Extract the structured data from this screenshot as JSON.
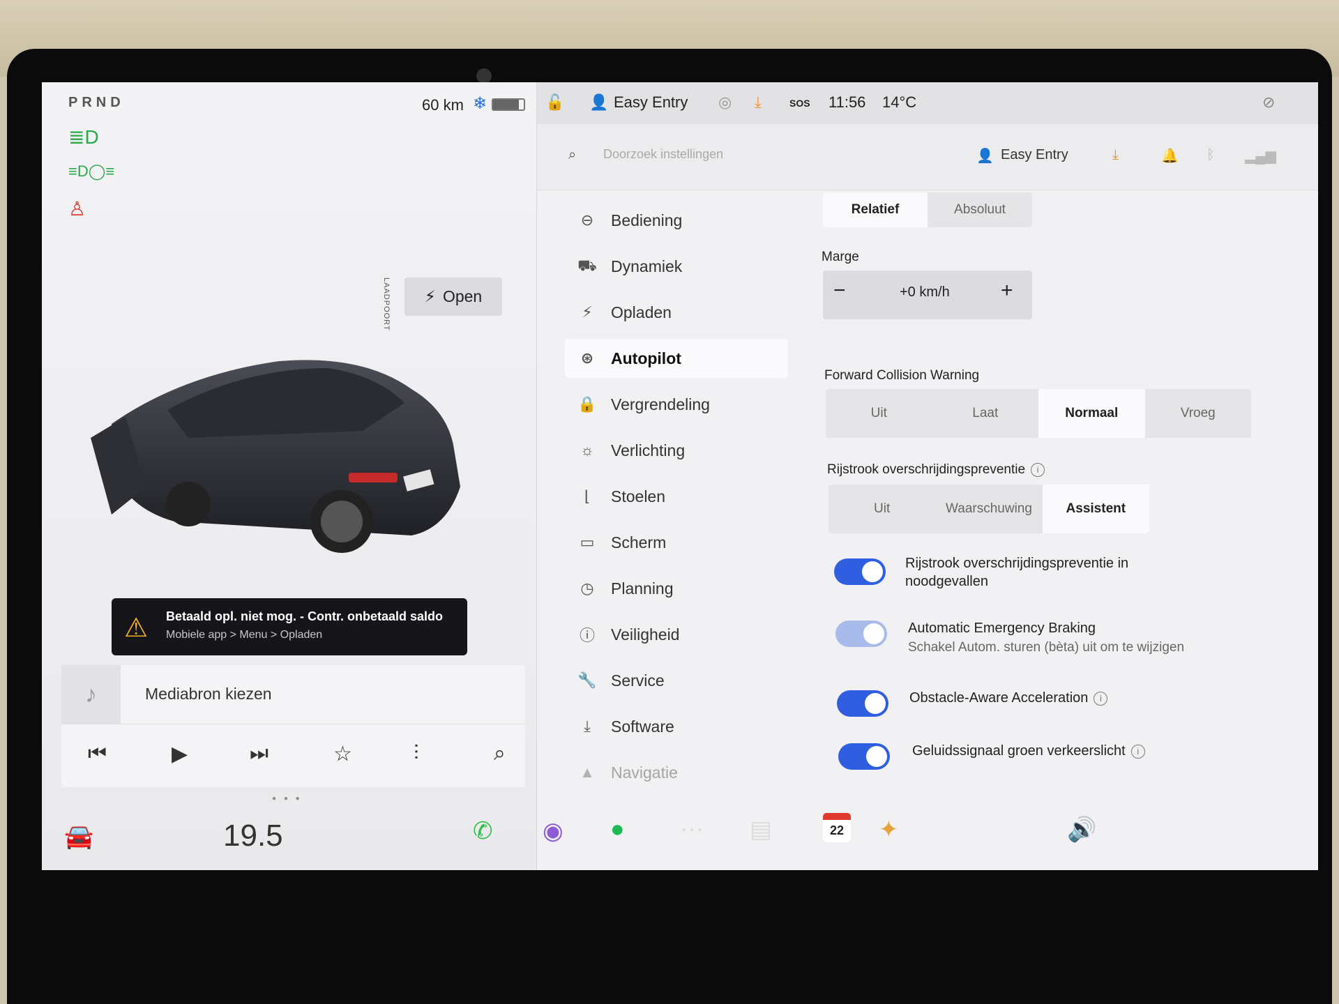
{
  "left": {
    "gear": "PRND",
    "range": "60 km",
    "battery_fraction": 0.85,
    "laadpoort_label": "LAADPOORT",
    "open_label": "Open",
    "alert": {
      "title": "Betaald opl. niet mog. - Contr. onbetaald saldo",
      "subtitle": "Mobiele app > Menu > Opladen"
    },
    "media": {
      "label": "Mediabron kiezen"
    }
  },
  "topbar": {
    "profile": "Easy Entry",
    "sos": "SOS",
    "time": "11:56",
    "temp": "14°C"
  },
  "search": {
    "placeholder": "Doorzoek instellingen",
    "profile": "Easy Entry"
  },
  "nav": {
    "items": [
      {
        "label": "Bediening",
        "icon": "toggle-icon"
      },
      {
        "label": "Dynamiek",
        "icon": "car-icon"
      },
      {
        "label": "Opladen",
        "icon": "bolt-icon"
      },
      {
        "label": "Autopilot",
        "icon": "steering-wheel-icon"
      },
      {
        "label": "Vergrendeling",
        "icon": "lock-icon"
      },
      {
        "label": "Verlichting",
        "icon": "light-icon"
      },
      {
        "label": "Stoelen",
        "icon": "seat-icon"
      },
      {
        "label": "Scherm",
        "icon": "display-icon"
      },
      {
        "label": "Planning",
        "icon": "clock-icon"
      },
      {
        "label": "Veiligheid",
        "icon": "warning-icon"
      },
      {
        "label": "Service",
        "icon": "wrench-icon"
      },
      {
        "label": "Software",
        "icon": "download-icon"
      },
      {
        "label": "Navigatie",
        "icon": "navigation-icon"
      }
    ],
    "active": "Autopilot"
  },
  "settings": {
    "speed_mode": {
      "options": [
        "Relatief",
        "Absoluut"
      ],
      "selected": "Relatief"
    },
    "marge": {
      "label": "Marge",
      "value": "+0 km/h",
      "minus": "−",
      "plus": "+"
    },
    "fcw": {
      "label": "Forward Collision Warning",
      "options": [
        "Uit",
        "Laat",
        "Normaal",
        "Vroeg"
      ],
      "selected": "Normaal"
    },
    "ldp": {
      "label": "Rijstrook overschrijdingspreventie",
      "options": [
        "Uit",
        "Waarschuwing",
        "Assistent"
      ],
      "selected": "Assistent"
    },
    "emergency_ldp": {
      "label_line1": "Rijstrook overschrijdingspreventie in",
      "label_line2": "noodgevallen",
      "on": true
    },
    "aeb": {
      "label": "Automatic Emergency Braking",
      "sub": "Schakel Autom. sturen (bèta) uit om te wijzigen",
      "on": true,
      "disabled": true
    },
    "oaa": {
      "label": "Obstacle-Aware Acceleration",
      "on": true
    },
    "green_light": {
      "label": "Geluidssignaal groen verkeerslicht",
      "on": true
    }
  },
  "taskbar": {
    "temp": "19.5",
    "calendar_day": "22"
  },
  "colors": {
    "accent": "#2f5fe0",
    "alert_bg": "#16161a",
    "warning": "#f3b227",
    "phone": "#2fbf4a",
    "spotify": "#1db954"
  }
}
